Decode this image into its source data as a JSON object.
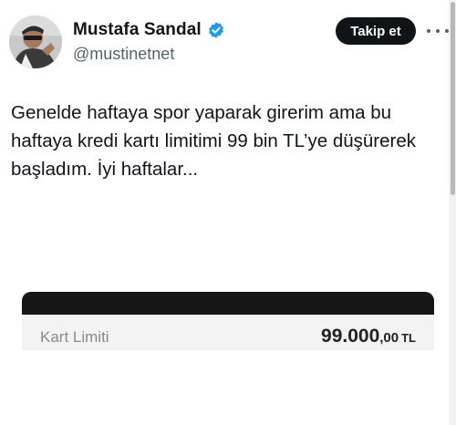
{
  "author": {
    "display_name": "Mustafa Sandal",
    "handle": "@mustinetnet",
    "avatar_icon": "avatar-photo",
    "verified_icon": "verified-badge-icon",
    "verified_color": "#1d9bf0"
  },
  "actions": {
    "follow_label": "Takip et",
    "more_icon": "more-options-icon"
  },
  "tweet": {
    "lines": [
      "Genelde haftaya spor yaparak girerim ama bu",
      "haftaya kredi kartı limitimi 99 bin TL’ye düşürerek",
      "başladım. İyi haftalar..."
    ]
  },
  "media": {
    "label": "Kart Limiti",
    "value_main": "99.000",
    "value_cents": ",00",
    "currency": "TL"
  },
  "colors": {
    "text_primary": "#0f1419",
    "text_secondary": "#536471",
    "follow_bg": "#0f1419"
  }
}
